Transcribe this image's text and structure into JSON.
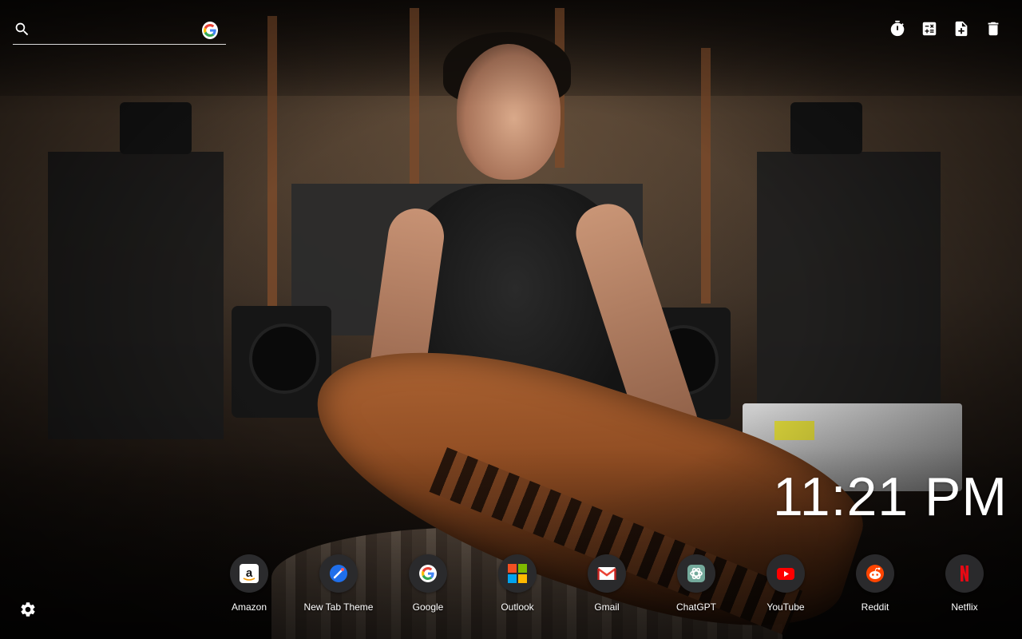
{
  "search": {
    "value": "",
    "placeholder": "",
    "icon": "search-icon",
    "engine_icon": "google-icon"
  },
  "toolbar": {
    "items": [
      {
        "name": "timer",
        "icon": "stopwatch-icon"
      },
      {
        "name": "calculator",
        "icon": "calculator-icon"
      },
      {
        "name": "new-note",
        "icon": "file-plus-icon"
      },
      {
        "name": "delete",
        "icon": "trash-icon"
      }
    ]
  },
  "clock": {
    "time": "11:21 PM"
  },
  "shortcuts": [
    {
      "label": "Amazon",
      "icon": "amazon-icon",
      "color": "#ffffff"
    },
    {
      "label": "New Tab Theme",
      "icon": "new-tab-theme-icon",
      "color": "#2b6fe3"
    },
    {
      "label": "Google",
      "icon": "google-icon",
      "color": "#4285f4"
    },
    {
      "label": "Outlook",
      "icon": "microsoft-icon",
      "color": "#f25022"
    },
    {
      "label": "Gmail",
      "icon": "gmail-icon",
      "color": "#ea4335"
    },
    {
      "label": "ChatGPT",
      "icon": "chatgpt-icon",
      "color": "#74aa9c"
    },
    {
      "label": "YouTube",
      "icon": "youtube-icon",
      "color": "#ff0000"
    },
    {
      "label": "Reddit",
      "icon": "reddit-icon",
      "color": "#ff4500"
    },
    {
      "label": "Netflix",
      "icon": "netflix-icon",
      "color": "#e50914"
    }
  ],
  "settings": {
    "icon": "gear-icon"
  },
  "background": {
    "description_colors": {
      "primary": "#3b2f25",
      "wood": "#8f4c22"
    }
  }
}
